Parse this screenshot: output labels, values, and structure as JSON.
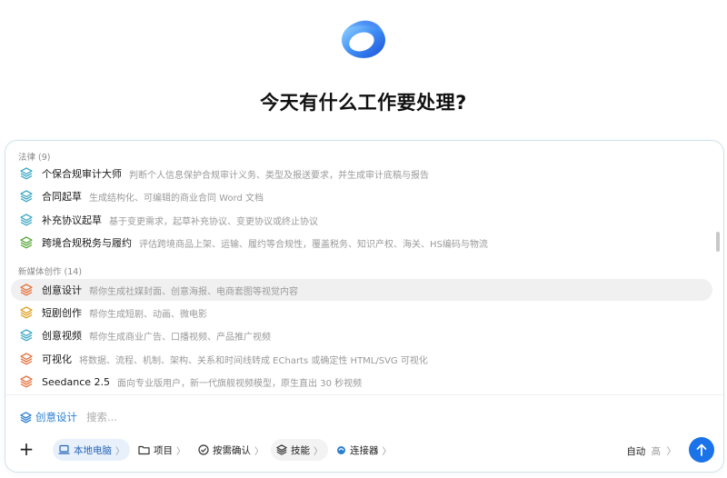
{
  "hero": {
    "headline": "今天有什么工作要处理?"
  },
  "skills": {
    "groups": [
      {
        "header": "法律 (9)",
        "items": [
          {
            "name": "个保合规审计大师",
            "desc": "判断个人信息保护合规审计义务、类型及报送要求，并生成审计底稿与报告",
            "icon_color": "#3ea9c4"
          },
          {
            "name": "合同起草",
            "desc": "生成结构化、可编辑的商业合同 Word 文档",
            "icon_color": "#3ea9c4"
          },
          {
            "name": "补充协议起草",
            "desc": "基于变更需求，起草补充协议、变更协议或终止协议",
            "icon_color": "#3ea9c4"
          },
          {
            "name": "跨境合规税务与履约",
            "desc": "评估跨境商品上架、运输、履约等合规性，覆盖税务、知识产权、海关、HS编码与物流",
            "icon_color": "#5aa83a"
          }
        ]
      },
      {
        "header": "新媒体创作 (14)",
        "items": [
          {
            "name": "创意设计",
            "desc": "帮你生成社媒封面、创意海报、电商套图等视觉内容",
            "icon_color": "#e8703a",
            "highlighted": true
          },
          {
            "name": "短剧创作",
            "desc": "帮你生成短剧、动画、微电影",
            "icon_color": "#e0a020"
          },
          {
            "name": "创意视频",
            "desc": "帮你生成商业广告、口播视频、产品推广视频",
            "icon_color": "#3ea9c4"
          },
          {
            "name": "可视化",
            "desc": "将数据、流程、机制、架构、关系和时间线转成 ECharts 或确定性 HTML/SVG 可视化",
            "icon_color": "#e8703a"
          },
          {
            "name": "Seedance 2.5",
            "desc": "面向专业版用户，新一代旗舰视频模型，原生直出 30 秒视频",
            "icon_color": "#e8703a"
          }
        ]
      }
    ]
  },
  "composer": {
    "selected_skill": "创意设计",
    "placeholder": "搜索...",
    "plus_label": "+",
    "toolbar": {
      "local": "本地电脑",
      "project": "项目",
      "confirm": "按需确认",
      "skills": "技能",
      "connector": "连接器",
      "chevron": "〉",
      "auto": "自动",
      "auto_level": "高",
      "auto_chevron": "〉"
    }
  },
  "colors": {
    "accent": "#1a73e8",
    "active_chip_bg": "#e8f1fb",
    "active_chip_text": "#2663b8"
  }
}
